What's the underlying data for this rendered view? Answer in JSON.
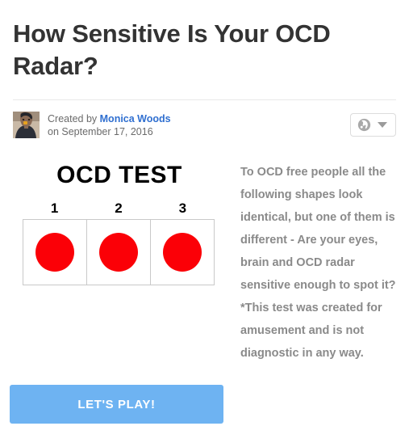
{
  "header": {
    "title": "How Sensitive Is Your OCD Radar?"
  },
  "author": {
    "created_by_label": "Created by",
    "author_name": "Monica Woods",
    "date_prefix": "on",
    "date": "September 17, 2016",
    "avatar_alt": "author-avatar-photo"
  },
  "privacy": {
    "icon": "globe-icon",
    "chevron": "chevron-down-icon",
    "visibility": "Public"
  },
  "figure": {
    "title": "OCD TEST",
    "numbers": [
      "1",
      "2",
      "3"
    ],
    "shape_color": "#fb0007",
    "cells": [
      {
        "label": "1",
        "shape": "circle"
      },
      {
        "label": "2",
        "shape": "circle"
      },
      {
        "label": "3",
        "shape": "circle"
      }
    ]
  },
  "description": {
    "text": "To OCD free people all the following shapes look identical, but one of them is different - Are your eyes, brain and OCD radar sensitive enough to spot it? *This test was created for amusement and is not diagnostic in any way."
  },
  "cta": {
    "label": "LET'S PLAY!",
    "color": "#6eb3f2"
  }
}
